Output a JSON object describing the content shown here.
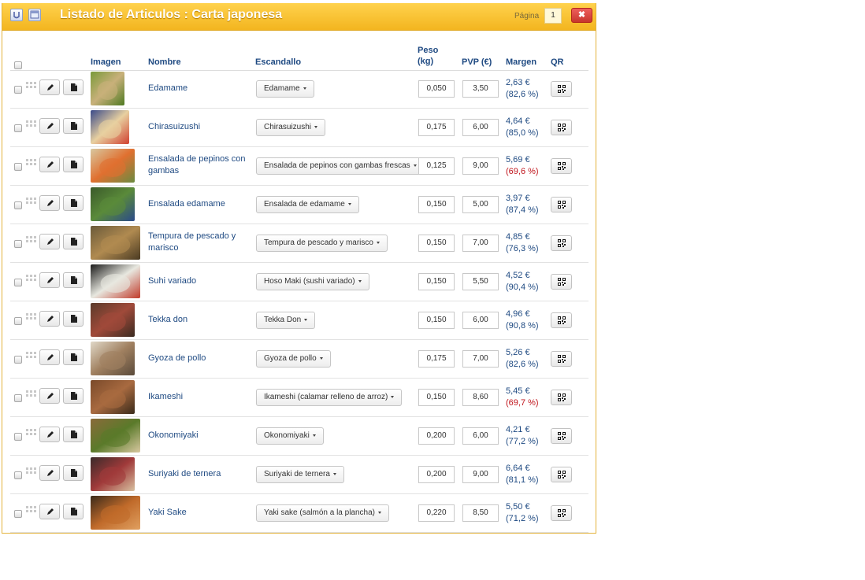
{
  "window": {
    "title": "Listado de Articulos : Carta japonesa",
    "page_label": "Página",
    "page_value": "1",
    "close_label": "✖"
  },
  "colors": {
    "header_gradient_top": "#ffd24d",
    "header_gradient_bottom": "#f3b51f",
    "link": "#1f4a82",
    "low_margin": "#c0141b",
    "close": "#d9443b"
  },
  "columns": {
    "imagen": "Imagen",
    "nombre": "Nombre",
    "escandallo": "Escandallo",
    "peso_line1": "Peso",
    "peso_line2": "(kg)",
    "pvp": "PVP (€)",
    "margen": "Margen",
    "qr": "QR"
  },
  "rows": [
    {
      "nombre": "Edamame",
      "escandallo": "Edamame",
      "peso": "0,050",
      "pvp": "3,50",
      "margen": "2,63 €",
      "pct": "(82,6 %)",
      "low": false,
      "img": [
        "#7a9a3a",
        "#c8b07a",
        "#4f7a22"
      ]
    },
    {
      "nombre": "Chirasuizushi",
      "escandallo": "Chirasuizushi",
      "peso": "0,175",
      "pvp": "6,00",
      "margen": "4,64 €",
      "pct": "(85,0 %)",
      "low": false,
      "img": [
        "#3a4a8a",
        "#e8d0a0",
        "#d04030"
      ]
    },
    {
      "nombre": "Ensalada de pepinos con gambas",
      "escandallo": "Ensalada de pepinos con gambas frescas",
      "peso": "0,125",
      "pvp": "9,00",
      "margen": "5,69 €",
      "pct": "(69,6 %)",
      "low": true,
      "img": [
        "#d8c8a0",
        "#e07030",
        "#6a8a40"
      ]
    },
    {
      "nombre": "Ensalada edamame",
      "escandallo": "Ensalada de edamame",
      "peso": "0,150",
      "pvp": "5,00",
      "margen": "3,97 €",
      "pct": "(87,4 %)",
      "low": false,
      "img": [
        "#3a5a2a",
        "#5a8a3a",
        "#2a4a8a"
      ]
    },
    {
      "nombre": "Tempura de pescado y marisco",
      "escandallo": "Tempura de pescado y marisco",
      "peso": "0,150",
      "pvp": "7,00",
      "margen": "4,85 €",
      "pct": "(76,3 %)",
      "low": false,
      "img": [
        "#6a5a3a",
        "#b08a50",
        "#4a3a22"
      ]
    },
    {
      "nombre": "Suhi variado",
      "escandallo": "Hoso Maki (sushi variado)",
      "peso": "0,150",
      "pvp": "5,50",
      "margen": "4,52 €",
      "pct": "(90,4 %)",
      "low": false,
      "img": [
        "#1a1a1a",
        "#e8e8e0",
        "#c03a2a"
      ]
    },
    {
      "nombre": "Tekka don",
      "escandallo": "Tekka Don",
      "peso": "0,150",
      "pvp": "6,00",
      "margen": "4,96 €",
      "pct": "(90,8 %)",
      "low": false,
      "img": [
        "#5a3a2a",
        "#a04a3a",
        "#3a2a20"
      ]
    },
    {
      "nombre": "Gyoza de pollo",
      "escandallo": "Gyoza de pollo",
      "peso": "0,175",
      "pvp": "7,00",
      "margen": "5,26 €",
      "pct": "(82,6 %)",
      "low": false,
      "img": [
        "#e0d8c8",
        "#a08060",
        "#5a4a3a"
      ]
    },
    {
      "nombre": "Ikameshi",
      "escandallo": "Ikameshi (calamar relleno de arroz)",
      "peso": "0,150",
      "pvp": "8,60",
      "margen": "5,45 €",
      "pct": "(69,7 %)",
      "low": true,
      "img": [
        "#7a4a2a",
        "#a86a40",
        "#3a2a1a"
      ]
    },
    {
      "nombre": "Okonomiyaki",
      "escandallo": "Okonomiyaki",
      "peso": "0,200",
      "pvp": "6,00",
      "margen": "4,21 €",
      "pct": "(77,2 %)",
      "low": false,
      "img": [
        "#8a6a3a",
        "#5a7a2a",
        "#d8c8a0"
      ]
    },
    {
      "nombre": "Suriyaki de ternera",
      "escandallo": "Suriyaki de ternera",
      "peso": "0,200",
      "pvp": "9,00",
      "margen": "6,64 €",
      "pct": "(81,1 %)",
      "low": false,
      "img": [
        "#3a2a2a",
        "#a03a3a",
        "#d8c0a0"
      ]
    },
    {
      "nombre": "Yaki Sake",
      "escandallo": "Yaki sake (salmón a la plancha)",
      "peso": "0,220",
      "pvp": "8,50",
      "margen": "5,50 €",
      "pct": "(71,2 %)",
      "low": false,
      "img": [
        "#3a2a1a",
        "#c06a2a",
        "#e0a060"
      ]
    }
  ]
}
